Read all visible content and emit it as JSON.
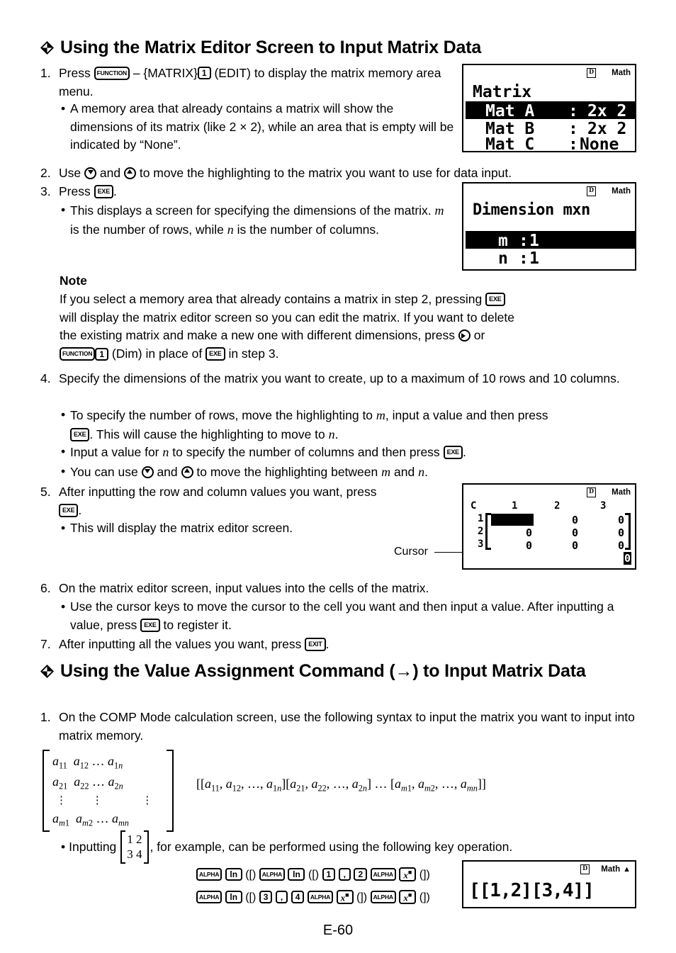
{
  "page": {
    "footer": "E-60"
  },
  "section1": {
    "heading": "Using the Matrix Editor Screen to Input Matrix Data",
    "step1": {
      "num": "1.",
      "pre": "Press",
      "key_function": "FUNCTION",
      "dash": "–",
      "matrix_menu": "{MATRIX}",
      "key_1": "1",
      "edit": "(EDIT)",
      "post": "to display the matrix memory area menu.",
      "bullet": "A memory area that already contains a matrix will show the dimensions of its matrix (like 2 × 2), while an area that is empty will be indicated by “None”."
    },
    "step2": {
      "num": "2.",
      "pre": "Use",
      "and": "and",
      "post": "to move the highlighting to the matrix you want to use for data input."
    },
    "step3": {
      "num": "3.",
      "pre": "Press",
      "key_exe": "EXE",
      "period": ".",
      "bullet_a": "This displays a screen for specifying the dimensions of the matrix.",
      "bullet_m": "m",
      "bullet_b": "is the number of rows, while",
      "bullet_n": "n",
      "bullet_c": "is the number of columns."
    },
    "note": {
      "title": "Note",
      "l1a": "If you select a memory area that already contains a matrix in step 2, pressing",
      "key_exe": "EXE",
      "l2": "will display the matrix editor screen so you can edit the matrix. If you want to delete",
      "l3a": "the existing matrix and make a new one with different dimensions, press",
      "l3b": "or",
      "key_function": "FUNCTION",
      "key_1": "1",
      "dim": "(Dim) in place of",
      "key_exe2": "EXE",
      "l4b": "in step 3."
    },
    "step4": {
      "num": "4.",
      "text": "Specify the dimensions of the matrix you want to create, up to a maximum of 10 rows and 10 columns.",
      "b1a": "To specify the number of rows, move the highlighting to",
      "b1m": "m",
      "b1b": ", input a value and then press",
      "key_exe": "EXE",
      "b1c": ". This will cause the highlighting to move to",
      "b1n": "n",
      "b1d": ".",
      "b2a": "Input a value for",
      "b2n": "n",
      "b2b": "to specify the number of columns and then press",
      "key_exe2": "EXE",
      "b2c": ".",
      "b3a": "You can use",
      "b3and": "and",
      "b3b": "to move the highlighting between",
      "b3m": "m",
      "b3and2": "and",
      "b3n": "n",
      "b3c": "."
    },
    "step5": {
      "num": "5.",
      "text": "After inputting the row and column values you want, press",
      "key_exe": "EXE",
      "period": ".",
      "bullet": "This will display the matrix editor screen.",
      "cursor_label": "Cursor"
    },
    "step6": {
      "num": "6.",
      "text": "On the matrix editor screen, input values into the cells of the matrix.",
      "b1a": "Use the cursor keys to move the cursor to the cell you want and then input a value. After inputting a value, press",
      "key_exe": "EXE",
      "b1b": "to register it."
    },
    "step7": {
      "num": "7.",
      "text": "After inputting all the values you want, press",
      "key_exit": "EXIT",
      "period": "."
    }
  },
  "section2": {
    "heading_a": "Using the Value Assignment Command (",
    "heading_arrow": "→",
    "heading_b": ") to Input Matrix Data",
    "step1": {
      "num": "1.",
      "text": "On the COMP Mode calculation screen, use the following syntax to input the matrix you want to input into matrix memory."
    },
    "matrix_display": {
      "rows": [
        [
          "a11",
          "a12",
          "…",
          "a1n"
        ],
        [
          "a21",
          "a22",
          "…",
          "a2n"
        ],
        [
          "⋮",
          "⋮",
          "",
          "⋮"
        ],
        [
          "am1",
          "am2",
          "…",
          "amn"
        ]
      ]
    },
    "syntax": "[[a11, a12, …, a1n][a21, a22, …, a2n] … [am1, am2, …, amn]]",
    "example": {
      "pre": "Inputting",
      "matrix": [
        [
          "1",
          "2"
        ],
        [
          "3",
          "4"
        ]
      ],
      "post": ", for example, can be performed using the following key operation."
    },
    "keyops": {
      "line1": [
        {
          "type": "key",
          "cls": "k-alpha",
          "label": "ALPHA"
        },
        {
          "type": "key",
          "cls": "k-ln",
          "label": "ln"
        },
        {
          "type": "paren",
          "label": "([)"
        },
        {
          "type": "key",
          "cls": "k-alpha",
          "label": "ALPHA"
        },
        {
          "type": "key",
          "cls": "k-ln",
          "label": "ln"
        },
        {
          "type": "paren",
          "label": "([)"
        },
        {
          "type": "key",
          "cls": "k-num",
          "label": "1"
        },
        {
          "type": "key",
          "cls": "k-comma",
          "label": ","
        },
        {
          "type": "key",
          "cls": "k-num",
          "label": "2"
        },
        {
          "type": "key",
          "cls": "k-alpha",
          "label": "ALPHA"
        },
        {
          "type": "key",
          "cls": "k-xsq",
          "label": "x■"
        },
        {
          "type": "paren",
          "label": "(])"
        }
      ],
      "line2": [
        {
          "type": "key",
          "cls": "k-alpha",
          "label": "ALPHA"
        },
        {
          "type": "key",
          "cls": "k-ln",
          "label": "ln"
        },
        {
          "type": "paren",
          "label": "([)"
        },
        {
          "type": "key",
          "cls": "k-num",
          "label": "3"
        },
        {
          "type": "key",
          "cls": "k-comma",
          "label": ","
        },
        {
          "type": "key",
          "cls": "k-num",
          "label": "4"
        },
        {
          "type": "key",
          "cls": "k-alpha",
          "label": "ALPHA"
        },
        {
          "type": "key",
          "cls": "k-xsq",
          "label": "x■"
        },
        {
          "type": "paren",
          "label": "(])"
        },
        {
          "type": "key",
          "cls": "k-alpha",
          "label": "ALPHA"
        },
        {
          "type": "key",
          "cls": "k-xsq",
          "label": "x■"
        },
        {
          "type": "paren",
          "label": "(])"
        }
      ]
    }
  },
  "lcd_screens": {
    "matrix_menu": {
      "status_d": "D",
      "status_math": "Math",
      "title": "Matrix",
      "rows": [
        {
          "name": "Mat A",
          "sep": ":",
          "value": "2x 2",
          "selected": true
        },
        {
          "name": "Mat B",
          "sep": ":",
          "value": "2x 2",
          "selected": false
        },
        {
          "name": "Mat C",
          "sep": ":",
          "value": "None",
          "selected": false
        }
      ]
    },
    "dimension": {
      "status_d": "D",
      "status_math": "Math",
      "title": "Dimension mxn",
      "rows": [
        {
          "label": "m",
          "sep": ":",
          "value": "1",
          "selected": true
        },
        {
          "label": "n",
          "sep": ":",
          "value": "1",
          "selected": false
        }
      ]
    },
    "matrix_editor": {
      "status_d": "D",
      "status_math": "Math",
      "corner": "C",
      "col_headers": [
        "1",
        "2",
        "3"
      ],
      "row_headers": [
        "1",
        "2",
        "3"
      ],
      "cells": [
        [
          "",
          "0",
          "0"
        ],
        [
          "0",
          "0",
          "0"
        ],
        [
          "0",
          "0",
          "0"
        ]
      ],
      "down_marker": "0"
    },
    "result": {
      "status_d": "D",
      "status_math": "Math",
      "status_arrow": "▲",
      "expression": "[[1,2][3,4]]"
    }
  }
}
